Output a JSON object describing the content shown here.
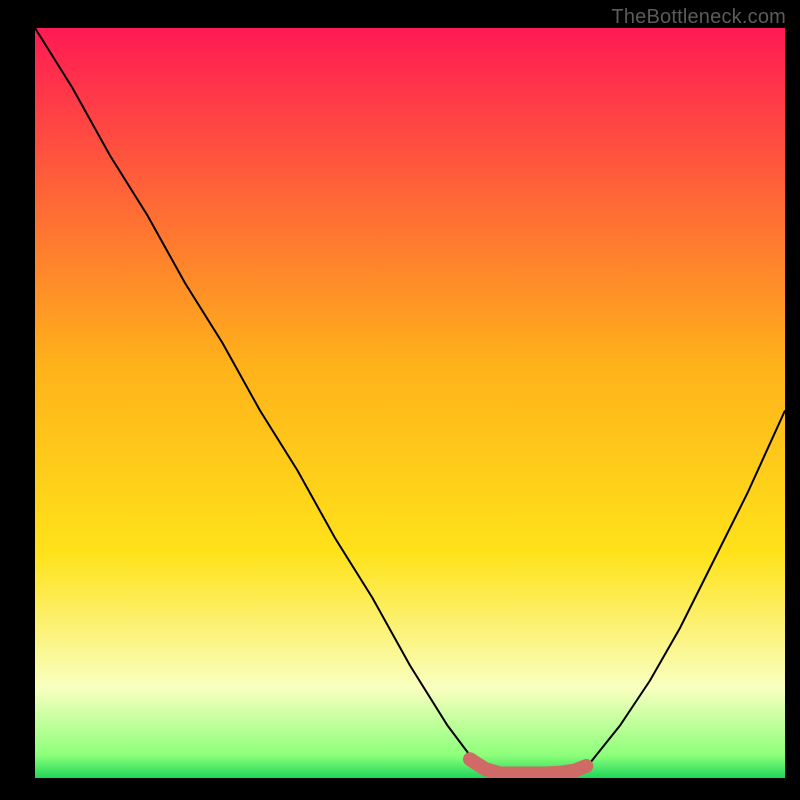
{
  "watermark": {
    "text": "TheBottleneck.com"
  },
  "colors": {
    "black": "#000000",
    "curve": "#000000",
    "series": "#cf6a66",
    "grad_top": "#ff1a54",
    "grad_mid1": "#ff9a1f",
    "grad_mid2": "#ffe21a",
    "grad_low": "#f6ffb8",
    "grad_green": "#1fd65a"
  },
  "chart_data": {
    "type": "line",
    "title": "",
    "xlabel": "",
    "ylabel": "",
    "xlim": [
      0,
      100
    ],
    "ylim": [
      0,
      100
    ],
    "gradient_stops": [
      {
        "pct": 0,
        "color": "#ff1a54"
      },
      {
        "pct": 45,
        "color": "#ffb21a"
      },
      {
        "pct": 70,
        "color": "#ffe21a"
      },
      {
        "pct": 88,
        "color": "#f9ffc0"
      },
      {
        "pct": 97,
        "color": "#8cff7a"
      },
      {
        "pct": 100,
        "color": "#1fd65a"
      }
    ],
    "curve": {
      "comment": "Bottleneck curve: y is mismatch (100=worst, 0=best). Minimum plateau around x≈62–72.",
      "x": [
        0,
        5,
        10,
        15,
        20,
        25,
        30,
        35,
        40,
        45,
        50,
        55,
        58,
        60,
        62,
        64,
        66,
        68,
        70,
        72,
        74,
        78,
        82,
        86,
        90,
        95,
        100
      ],
      "y": [
        100,
        92,
        83,
        75,
        66,
        58,
        49,
        41,
        32,
        24,
        15,
        7,
        3,
        1,
        0,
        0,
        0,
        0,
        0,
        0.5,
        2,
        7,
        13,
        20,
        28,
        38,
        49
      ]
    },
    "series": [
      {
        "name": "highlight",
        "comment": "Thick salmon near-minimum segment",
        "x": [
          58,
          60,
          62,
          64,
          66,
          68,
          70,
          72,
          73.5
        ],
        "y": [
          2.5,
          1.2,
          0.6,
          0.6,
          0.6,
          0.6,
          0.7,
          1.0,
          1.6
        ]
      }
    ]
  }
}
